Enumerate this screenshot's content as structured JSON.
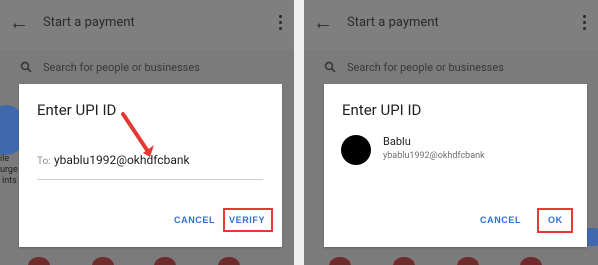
{
  "panels": {
    "left": {
      "appbar_title": "Start a payment",
      "search_placeholder": "Search for people or businesses",
      "side_text": [
        "ile",
        "urge",
        "ints"
      ],
      "dialog": {
        "title": "Enter UPI ID",
        "input_prefix": "To:",
        "input_value": "ybablu1992@okhdfcbank",
        "cancel_label": "CANCEL",
        "verify_label": "VERIFY"
      }
    },
    "right": {
      "appbar_title": "Start a payment",
      "search_placeholder": "Search for people or businesses",
      "dialog": {
        "title": "Enter UPI ID",
        "contact_name": "Bablu",
        "contact_id": "ybablu1992@okhdfcbank",
        "cancel_label": "CANCEL",
        "ok_label": "OK"
      }
    }
  }
}
